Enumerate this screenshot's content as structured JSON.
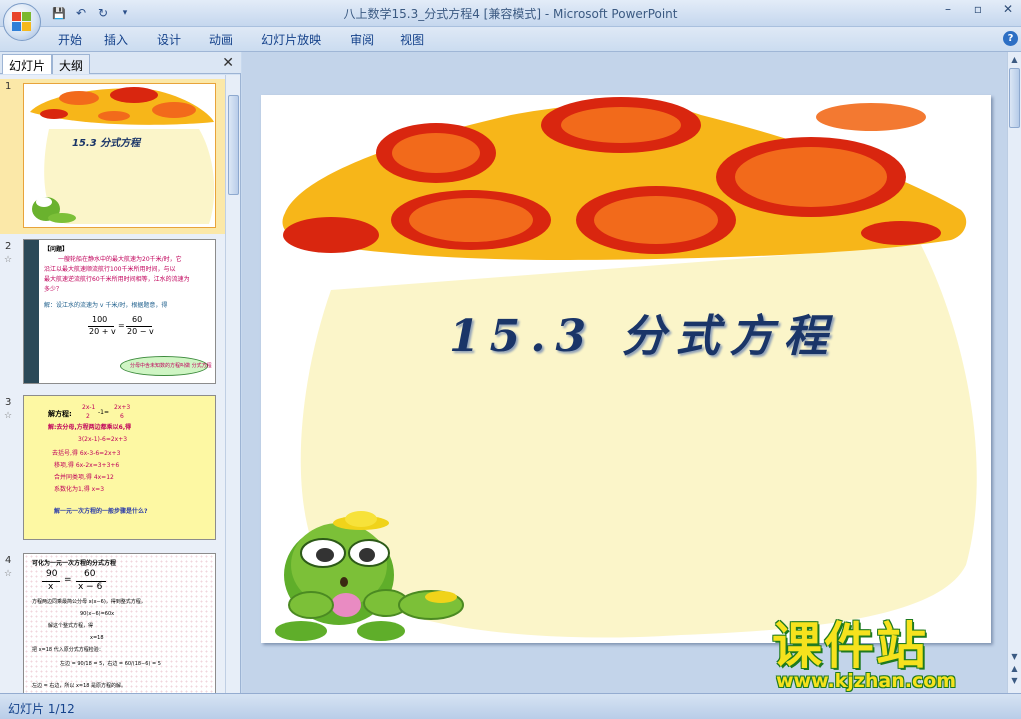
{
  "window": {
    "title": "八上数学15.3_分式方程4 [兼容模式] - Microsoft PowerPoint",
    "minimize": "–",
    "restore": "▫",
    "close": "✕"
  },
  "qat": {
    "save": "💾",
    "undo": "↶",
    "redo": "↻",
    "more": "▾"
  },
  "ribbon": {
    "tabs": [
      "开始",
      "插入",
      "设计",
      "动画",
      "幻灯片放映",
      "审阅",
      "视图"
    ],
    "help": "?"
  },
  "pane": {
    "tabs": [
      "幻灯片",
      "大纲"
    ],
    "close": "✕"
  },
  "thumbnails": [
    {
      "num": "1",
      "title": "15.3  分式方程"
    },
    {
      "num": "2",
      "star": "☆",
      "lines": [
        "【问题】",
        "一艘轮船在静水中的最大航速为20千米/时，它",
        "沿江以最大航速顺流航行100千米所用时间，与以",
        "最大航速逆流航行60千米所用时间相等，江水的流速为",
        "多少？",
        "解：设江水的流速为 v 千米/时，根据题意，得"
      ],
      "eq_left_num": "100",
      "eq_left_den": "20 + v",
      "eq_eq": "=",
      "eq_right_num": "60",
      "eq_right_den": "20 − v",
      "callout": "分母中含未知数的方程叫做 分式方程"
    },
    {
      "num": "3",
      "star": "☆",
      "lines": [
        "解方程:",
        "解:去分母,方程两边都乘以6,得",
        "3(2x-1)-6=2x+3",
        "去括号,得  6x-3-6=2x+3",
        "移项,得     6x-2x=3+3+6",
        "合并同类项,得 4x=12",
        "系数化为1,得   x=3",
        "解一元一次方程的一般步骤是什么?"
      ],
      "frac1_num": "2x-1",
      "frac1_den": "2",
      "minus_one": "-1=",
      "frac2_num": "2x+3",
      "frac2_den": "6"
    },
    {
      "num": "4",
      "star": "☆",
      "lines": [
        "可化为一元一次方程的分式方程",
        "方程两边同乘最简公分母 x(x−6)，得到整式方程，",
        "90(x−6)=60x",
        "解这个整式方程，得",
        "x=18",
        "把 x=18 代入原分式方程检验：",
        "左边 = 90/18 = 5，右边 = 60/(18−6) = 5",
        "左边 = 右边，所以 x=18 是原方程的解。"
      ],
      "frac1_num": "90",
      "frac1_den": "x",
      "eq": "=",
      "frac2_num": "60",
      "frac2_den": "x − 6"
    }
  ],
  "slide": {
    "title": "15.3  分式方程"
  },
  "status": {
    "text": "幻灯片 1/12"
  },
  "watermark": {
    "cn": "课件站",
    "url": "www.kjzhan.com"
  },
  "colors": {
    "mushroom_orange": "#f26a1b",
    "mushroom_red": "#d9260f",
    "mushroom_yellow": "#f7b619",
    "stem": "#fbf5c9",
    "title": "#1a3568"
  }
}
